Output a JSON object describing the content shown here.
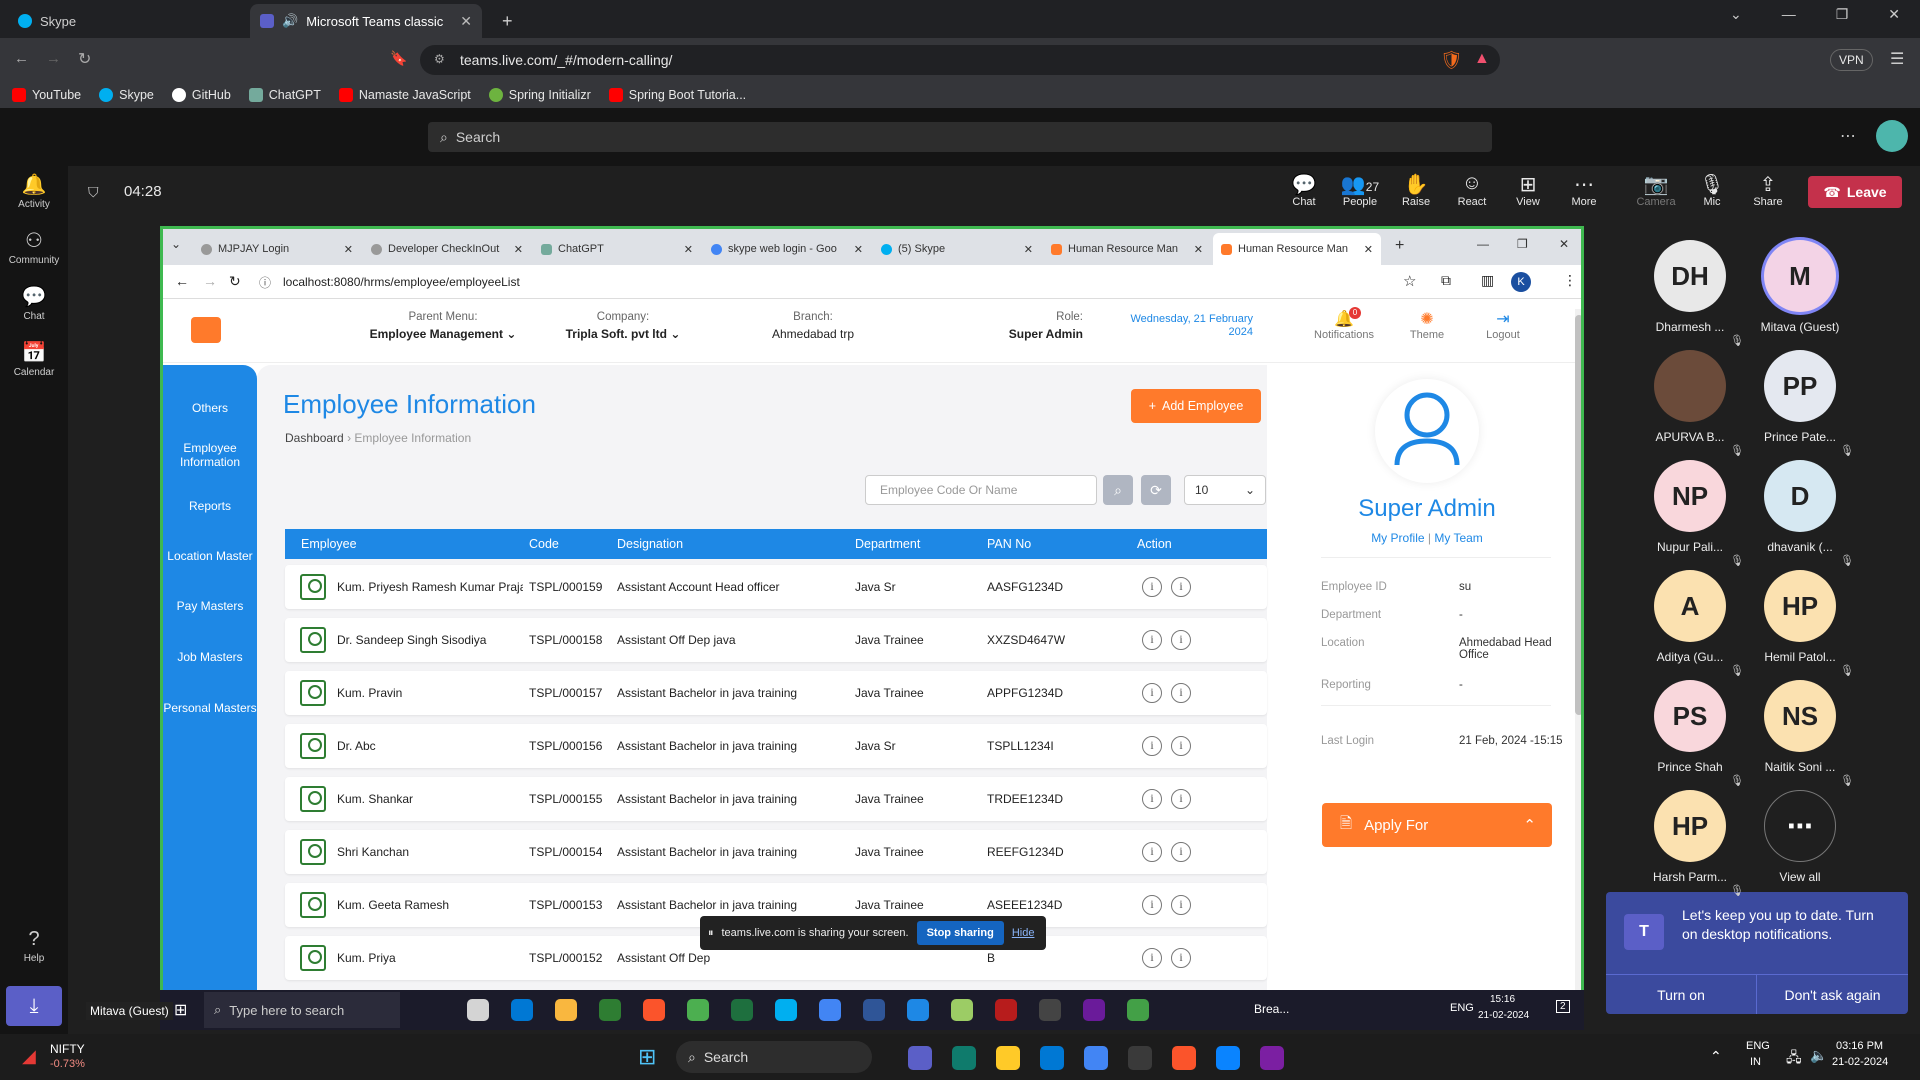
{
  "outer_tabs": [
    {
      "label": "Skype"
    },
    {
      "label": "Microsoft Teams classic - loa"
    }
  ],
  "outer_url": "teams.live.com/_#/modern-calling/",
  "vpn": "VPN",
  "bookmarks": [
    "YouTube",
    "Skype",
    "GitHub",
    "ChatGPT",
    "Namaste JavaScript",
    "Spring Initializr",
    "Spring Boot Tutoria..."
  ],
  "teams_search": "Search",
  "rail": [
    "Activity",
    "Community",
    "Chat",
    "Calendar",
    "Help"
  ],
  "call_timer": "04:28",
  "call_controls": [
    {
      "label": "Chat"
    },
    {
      "label": "People",
      "count": "27"
    },
    {
      "label": "Raise"
    },
    {
      "label": "React"
    },
    {
      "label": "View"
    },
    {
      "label": "More"
    },
    {
      "label": "Camera"
    },
    {
      "label": "Mic"
    },
    {
      "label": "Share"
    }
  ],
  "leave": "Leave",
  "inner_tabs": [
    "MJPJAY Login",
    "Developer CheckInOut",
    "ChatGPT",
    "skype web login - Goo",
    "(5) Skype",
    "Human Resource Man",
    "Human Resource Man"
  ],
  "inner_url": "localhost:8080/hrms/employee/employeeList",
  "profile_initial": "K",
  "header": {
    "parent_menu_label": "Parent Menu:",
    "parent_menu": "Employee Management",
    "company_label": "Company:",
    "company": "Tripla Soft. pvt ltd",
    "branch_label": "Branch:",
    "branch": "Ahmedabad trp",
    "role_label": "Role:",
    "role": "Super Admin",
    "date_line1": "Wednesday, 21 February",
    "date_line2": "2024",
    "notifications": "Notifications",
    "notif_count": "0",
    "theme": "Theme",
    "logout": "Logout"
  },
  "sidenav": [
    "Others",
    "Employee Information",
    "Reports",
    "Location Master",
    "Pay Masters",
    "Job Masters",
    "Personal Masters"
  ],
  "page_title": "Employee Information",
  "breadcrumb": {
    "home": "Dashboard",
    "current": "Employee Information"
  },
  "add_employee": "Add Employee",
  "search_placeholder": "Employee Code Or Name",
  "page_size": "10",
  "table": {
    "columns": [
      "Employee",
      "Code",
      "Designation",
      "Department",
      "PAN No",
      "Action"
    ],
    "rows": [
      {
        "name": "Kum. Priyesh Ramesh Kumar Prajapati",
        "code": "TSPL/000159",
        "designation": "Assistant Account Head officer",
        "department": "Java Sr",
        "pan": "AASFG1234D"
      },
      {
        "name": "Dr. Sandeep Singh Sisodiya",
        "code": "TSPL/000158",
        "designation": "Assistant Off Dep java",
        "department": "Java Trainee",
        "pan": "XXZSD4647W"
      },
      {
        "name": "Kum. Pravin",
        "code": "TSPL/000157",
        "designation": "Assistant Bachelor in java training",
        "department": "Java Trainee",
        "pan": "APPFG1234D"
      },
      {
        "name": "Dr. Abc",
        "code": "TSPL/000156",
        "designation": "Assistant Bachelor in java training",
        "department": "Java Sr",
        "pan": "TSPLL1234I"
      },
      {
        "name": "Kum. Shankar",
        "code": "TSPL/000155",
        "designation": "Assistant Bachelor in java training",
        "department": "Java Trainee",
        "pan": "TRDEE1234D"
      },
      {
        "name": "Shri Kanchan",
        "code": "TSPL/000154",
        "designation": "Assistant Bachelor in java training",
        "department": "Java Trainee",
        "pan": "REEFG1234D"
      },
      {
        "name": "Kum. Geeta Ramesh",
        "code": "TSPL/000153",
        "designation": "Assistant Bachelor in java training",
        "department": "Java Trainee",
        "pan": "ASEEE1234D"
      },
      {
        "name": "Kum. Priya",
        "code": "TSPL/000152",
        "designation": "Assistant Off Dep",
        "department": "",
        "pan": "B"
      }
    ]
  },
  "profile": {
    "name": "Super Admin",
    "my_profile": "My Profile",
    "sep": "|",
    "my_team": "My Team",
    "fields": [
      {
        "label": "Employee ID",
        "value": "su"
      },
      {
        "label": "Department",
        "value": "-"
      },
      {
        "label": "Location",
        "value": "Ahmedabad Head Office"
      },
      {
        "label": "Reporting",
        "value": "-"
      },
      {
        "label": "Last Login",
        "value": "21 Feb, 2024 -15:15"
      }
    ],
    "apply_for": "Apply For"
  },
  "share_bar": {
    "text": "teams.live.com is sharing your screen.",
    "stop": "Stop sharing",
    "hide": "Hide"
  },
  "inner_taskbar": {
    "user": "Mitava (Guest)",
    "search": "Type here to search",
    "weather": "Brea...",
    "lang": "ENG",
    "time": "15:16",
    "date": "21-02-2024",
    "badge": "2"
  },
  "participants": [
    {
      "initials": "DH",
      "name": "Dharmesh ...",
      "color": "#e8e8e8"
    },
    {
      "initials": "M",
      "name": "Mitava (Guest)",
      "color": "#f3d3e6"
    },
    {
      "initials": "",
      "name": "APURVA B...",
      "color": "#6b4b3a"
    },
    {
      "initials": "PP",
      "name": "Prince Pate...",
      "color": "#e4e8f0"
    },
    {
      "initials": "NP",
      "name": "Nupur Pali...",
      "color": "#f9d7dc"
    },
    {
      "initials": "D",
      "name": "dhavanik (...",
      "color": "#d6e8f2"
    },
    {
      "initials": "A",
      "name": "Aditya (Gu...",
      "color": "#fbe1b0"
    },
    {
      "initials": "HP",
      "name": "Hemil Patol...",
      "color": "#fbe1b0"
    },
    {
      "initials": "PS",
      "name": "Prince Shah",
      "color": "#f9d7dc"
    },
    {
      "initials": "NS",
      "name": "Naitik Soni ...",
      "color": "#fbe1b0"
    },
    {
      "initials": "HP",
      "name": "Harsh Parm...",
      "color": "#fbe1b0"
    },
    {
      "initials": "⋯",
      "name": "View all",
      "color": "#1f1f1f"
    }
  ],
  "notification": {
    "text": "Let's keep you up to date. Turn on desktop notifications.",
    "turn_on": "Turn on",
    "dont_ask": "Don't ask again"
  },
  "taskbar": {
    "ticker": "NIFTY",
    "change": "-0.73%",
    "search": "Search",
    "lang1": "ENG",
    "lang2": "IN",
    "time": "03:16 PM",
    "date": "21-02-2024"
  }
}
